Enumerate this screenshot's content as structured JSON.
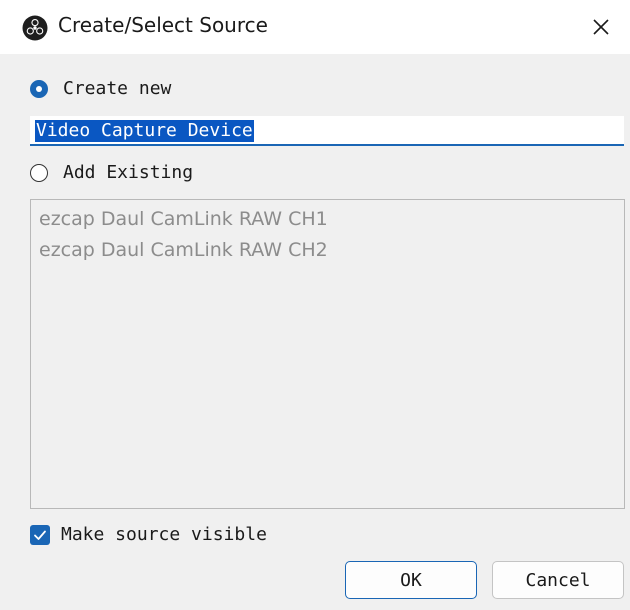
{
  "window": {
    "title": "Create/Select Source",
    "app_icon": "obs-logo-icon",
    "close_icon": "close-icon"
  },
  "create_new": {
    "label": "Create new",
    "selected": true,
    "name_value": "Video Capture Device"
  },
  "add_existing": {
    "label": "Add Existing",
    "selected": false,
    "items": [
      {
        "label": "ezcap Daul CamLink RAW CH1"
      },
      {
        "label": "ezcap Daul CamLink RAW CH2"
      }
    ]
  },
  "make_visible": {
    "label": "Make source visible",
    "checked": true
  },
  "buttons": {
    "ok_label": "OK",
    "cancel_label": "Cancel"
  },
  "colors": {
    "accent": "#1a66b5",
    "selection": "#0a57c2",
    "dialog_bg": "#f0f0f0",
    "disabled_text": "#8c8c8c"
  }
}
